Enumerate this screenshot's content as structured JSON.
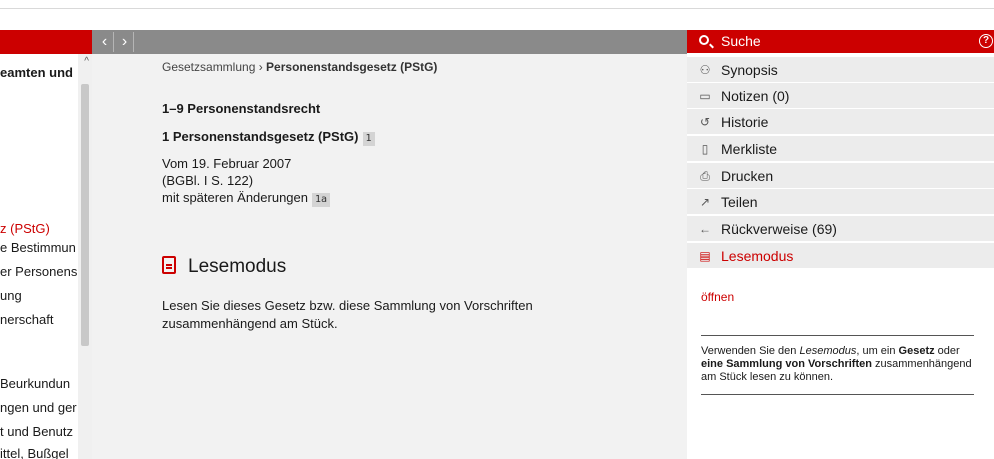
{
  "left_tree": {
    "items": [
      {
        "text": "eamten und",
        "style": "bold"
      },
      {
        "text": "z (PStG)",
        "style": "red"
      },
      {
        "text": "e Bestimmun",
        "style": "normal"
      },
      {
        "text": "er Personens",
        "style": "normal"
      },
      {
        "text": "ung",
        "style": "normal"
      },
      {
        "text": "nerschaft",
        "style": "normal"
      },
      {
        "text": "Beurkundun",
        "style": "normal"
      },
      {
        "text": "ngen und ger",
        "style": "normal"
      },
      {
        "text": "t und Benutz",
        "style": "normal"
      },
      {
        "text": "ittel, Bußgel",
        "style": "normal"
      }
    ]
  },
  "nav": {
    "prev_label": "‹",
    "next_label": "›"
  },
  "breadcrumb": {
    "root": "Gesetzsammlung",
    "separator": " › ",
    "current": "Personenstandsgesetz (PStG)"
  },
  "document": {
    "section_title": "1–9 Personenstandsrecht",
    "law_title": "1  Personenstandsgesetz (PStG)",
    "law_footnote": "1",
    "date_line": "Vom 19. Februar 2007",
    "source_line": "(BGBl. I S. 122)",
    "changes_line": "mit späteren Änderungen",
    "changes_footnote": "1a",
    "lesemodus_heading": "Lesemodus",
    "lesemodus_text": "Lesen Sie dieses Gesetz bzw. diese Sammlung von Vorschriften zusammenhängend am Stück."
  },
  "right_panel": {
    "search_label": "Suche",
    "help_label": "?",
    "menu": [
      {
        "label": "Synopsis",
        "icon": "synopsis-icon",
        "glyph": "⚇"
      },
      {
        "label": "Notizen (0)",
        "icon": "comment-icon",
        "glyph": "▭"
      },
      {
        "label": "Historie",
        "icon": "history-icon",
        "glyph": "↺"
      },
      {
        "label": "Merkliste",
        "icon": "bookmark-icon",
        "glyph": "▯"
      },
      {
        "label": "Drucken",
        "icon": "print-icon",
        "glyph": "⎙"
      },
      {
        "label": "Teilen",
        "icon": "share-icon",
        "glyph": "↗"
      },
      {
        "label": "Rückverweise (69)",
        "icon": "back-arrow-icon",
        "glyph": "←"
      },
      {
        "label": "Lesemodus",
        "icon": "document-icon",
        "glyph": "▤"
      }
    ],
    "open_link": "öffnen",
    "info_pre": "Verwenden Sie den ",
    "info_em": "Lesemodus",
    "info_mid": ", um ein ",
    "info_b1": "Gesetz",
    "info_mid2": " oder ",
    "info_b2": "eine Sammlung von Vorschriften",
    "info_post": " zusammenhängend am Stück lesen zu können."
  },
  "colors": {
    "accent": "#cc0000",
    "toolbar": "#8a8a8a",
    "panel_bg": "#f2f2f2",
    "menu_bg": "#ececec"
  }
}
